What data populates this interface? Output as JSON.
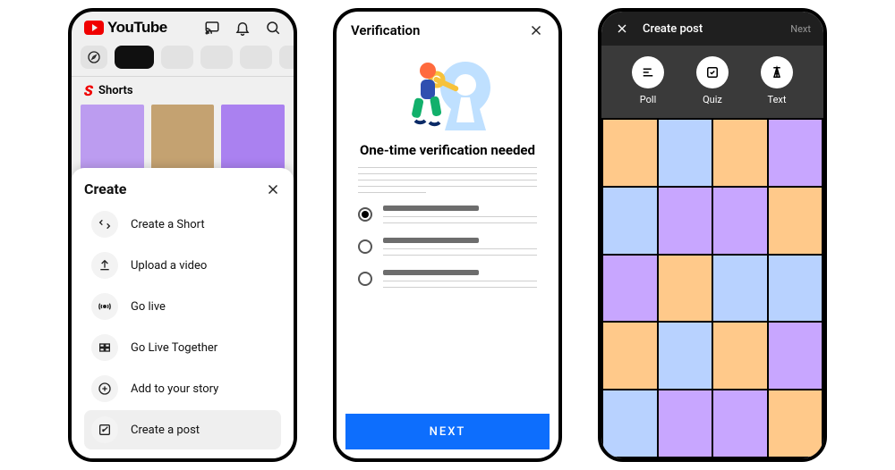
{
  "phone1": {
    "brand_word": "YouTube",
    "shorts_label": "Shorts",
    "sheet_title": "Create",
    "items": [
      {
        "label": "Create a Short"
      },
      {
        "label": "Upload a video"
      },
      {
        "label": "Go live"
      },
      {
        "label": "Go Live Together"
      },
      {
        "label": "Add to your story"
      },
      {
        "label": "Create a post"
      }
    ]
  },
  "phone2": {
    "header": "Verification",
    "heading": "One-time verification needed",
    "cta": "NEXT"
  },
  "phone3": {
    "title": "Create post",
    "next_label": "Next",
    "types": [
      {
        "label": "Poll"
      },
      {
        "label": "Quiz"
      },
      {
        "label": "Text"
      }
    ],
    "grid_colors": [
      "#ffc98a",
      "#b8d2ff",
      "#ffc98a",
      "#c8a6ff",
      "#b8d2ff",
      "#c8a6ff",
      "#c8a6ff",
      "#ffc98a",
      "#c8a6ff",
      "#ffc98a",
      "#b8d2ff",
      "#b8d2ff",
      "#ffc98a",
      "#b8d2ff",
      "#ffc98a",
      "#c8a6ff",
      "#b8d2ff",
      "#c8a6ff",
      "#c8a6ff",
      "#ffc98a"
    ]
  }
}
